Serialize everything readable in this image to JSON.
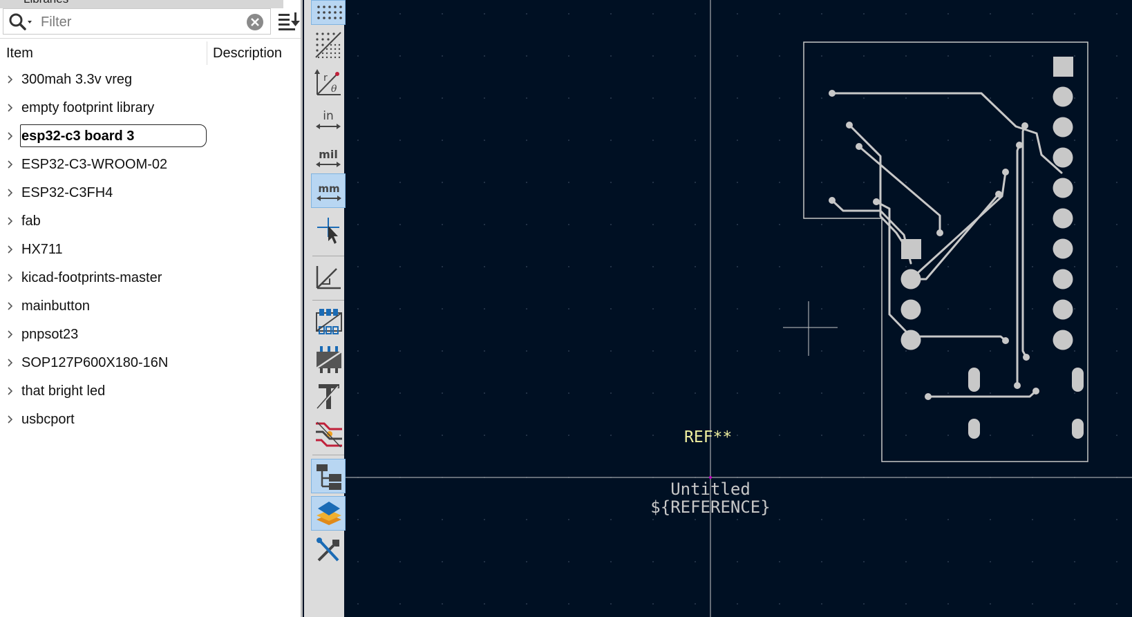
{
  "library": {
    "title": "Libraries",
    "filter": {
      "value": "",
      "placeholder": "Filter"
    },
    "columns": {
      "item": "Item",
      "description": "Description"
    },
    "items": [
      {
        "label": "300mah 3.3v vreg"
      },
      {
        "label": "empty footprint library"
      },
      {
        "label": "esp32-c3 board 3",
        "selected": true
      },
      {
        "label": "ESP32-C3-WROOM-02"
      },
      {
        "label": "ESP32-C3FH4"
      },
      {
        "label": "fab"
      },
      {
        "label": "HX711"
      },
      {
        "label": "kicad-footprints-master"
      },
      {
        "label": "mainbutton"
      },
      {
        "label": "pnpsot23"
      },
      {
        "label": "SOP127P600X180-16N"
      },
      {
        "label": "that bright led"
      },
      {
        "label": "usbcport"
      }
    ]
  },
  "toolbar": {
    "buttons": [
      {
        "icon": "grid-icon",
        "active": true
      },
      {
        "icon": "grid-overrides-icon",
        "active": false
      },
      {
        "icon": "polar-coordinates-icon",
        "active": false
      },
      {
        "icon": "inches-icon",
        "label": "in",
        "active": false
      },
      {
        "icon": "mils-icon",
        "label": "mil",
        "active": false
      },
      {
        "icon": "millimeters-icon",
        "label": "mm",
        "active": true
      },
      {
        "icon": "full-crosshair-cursor-icon",
        "active": false
      },
      {
        "icon": "angle-constraint-icon",
        "active": false
      },
      {
        "icon": "pad-sketch-mode-icon",
        "active": false
      },
      {
        "icon": "graphics-sketch-mode-icon",
        "active": false
      },
      {
        "icon": "text-sketch-mode-icon",
        "active": false
      },
      {
        "icon": "high-contrast-mode-icon",
        "active": false
      },
      {
        "icon": "footprint-tree-icon",
        "active": true
      },
      {
        "icon": "layers-manager-icon",
        "active": true
      },
      {
        "icon": "properties-manager-icon",
        "active": false
      }
    ]
  },
  "canvas": {
    "ref_text": "REF**",
    "value_text": "Untitled",
    "reference_text": "${REFERENCE}",
    "colors": {
      "background": "#001023",
      "copper": "#c8c8c8",
      "ref": "#f0f0a0",
      "fab": "#c8c8c8",
      "axis": "#c8c8c8"
    }
  }
}
